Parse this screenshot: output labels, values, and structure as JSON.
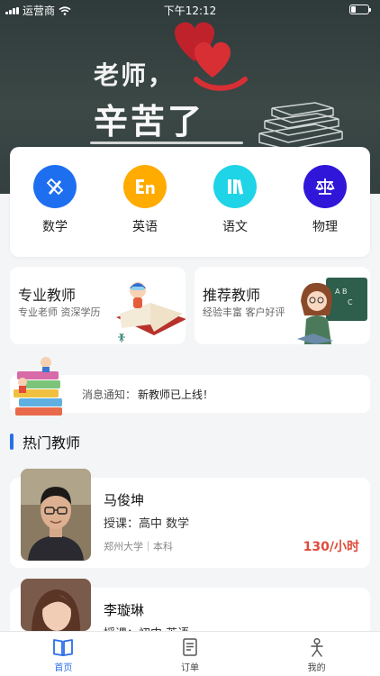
{
  "status_bar": {
    "carrier": "运营商",
    "time": "下午12:12"
  },
  "banner": {
    "line1": "老师，",
    "line2": "辛苦了"
  },
  "subjects": [
    {
      "label": "数学",
      "icon": "pencil-ruler-icon",
      "color": "#1e6ff0"
    },
    {
      "label": "英语",
      "icon": "en-letters-icon",
      "color": "#ffab00"
    },
    {
      "label": "语文",
      "icon": "books-icon",
      "color": "#1ed4e6"
    },
    {
      "label": "物理",
      "icon": "balance-scale-icon",
      "color": "#2f16d9"
    }
  ],
  "promos": [
    {
      "title": "专业教师",
      "subtitle": "专业老师 资深学历"
    },
    {
      "title": "推荐教师",
      "subtitle": "经验丰富 客户好评"
    }
  ],
  "notice": {
    "label": "消息通知：",
    "text": "新教师已上线！"
  },
  "section": {
    "title": "热门教师"
  },
  "teachers": [
    {
      "name": "马俊坤",
      "course": "授课：高中 数学",
      "education": "郑州大学｜本科",
      "price": "130/小时"
    },
    {
      "name": "李璇琳",
      "course": "授课：初中 英语"
    }
  ],
  "tabbar": [
    {
      "label": "首页",
      "icon": "book-icon",
      "active": true
    },
    {
      "label": "订单",
      "icon": "document-icon",
      "active": false
    },
    {
      "label": "我的",
      "icon": "person-icon",
      "active": false
    }
  ],
  "colors": {
    "accent": "#2a6fe8",
    "price": "#e04b3c"
  }
}
